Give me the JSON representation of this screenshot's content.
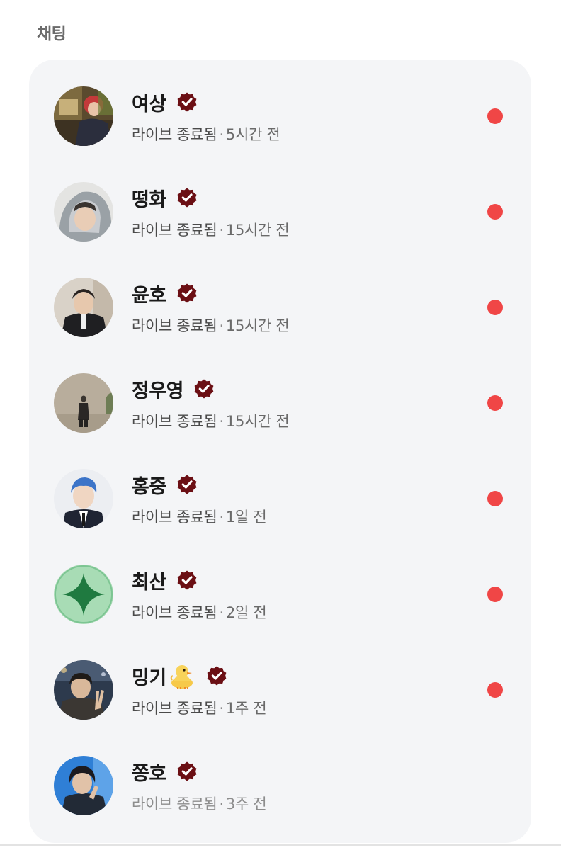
{
  "section": {
    "title": "채팅"
  },
  "colors": {
    "card_background": "#f4f5f7",
    "verified_badge": "#6b0f14",
    "unread_dot": "#f04646"
  },
  "chats": [
    {
      "name": "여상",
      "emoji": "",
      "status": "라이브 종료됨",
      "time": "5시간 전",
      "unread": true,
      "avatar": "photo-red-hair"
    },
    {
      "name": "떵화",
      "emoji": "",
      "status": "라이브 종료됨",
      "time": "15시간 전",
      "unread": true,
      "avatar": "photo-hood"
    },
    {
      "name": "윤호",
      "emoji": "",
      "status": "라이브 종료됨",
      "time": "15시간 전",
      "unread": true,
      "avatar": "photo-dark-suit"
    },
    {
      "name": "정우영",
      "emoji": "",
      "status": "라이브 종료됨",
      "time": "15시간 전",
      "unread": true,
      "avatar": "photo-standing"
    },
    {
      "name": "홍중",
      "emoji": "",
      "status": "라이브 종료됨",
      "time": "1일 전",
      "unread": true,
      "avatar": "photo-blue-hair"
    },
    {
      "name": "최산",
      "emoji": "",
      "status": "라이브 종료됨",
      "time": "2일 전",
      "unread": true,
      "avatar": "green-sparkle"
    },
    {
      "name": "밍기",
      "emoji": "chick-emoji",
      "status": "라이브 종료됨",
      "time": "1주 전",
      "unread": true,
      "avatar": "photo-peace"
    },
    {
      "name": "쫑호",
      "emoji": "",
      "status": "라이브 종료됨",
      "time": "3주 전",
      "unread": false,
      "avatar": "photo-blue-bg"
    }
  ]
}
